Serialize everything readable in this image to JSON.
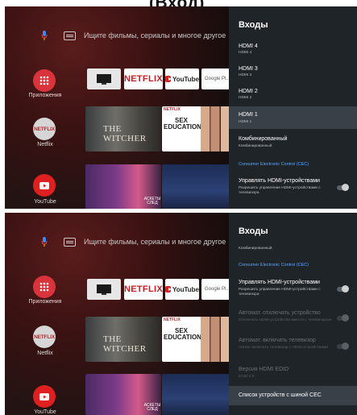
{
  "header": {
    "visible_fragment": "(Вход)"
  },
  "search": {
    "placeholder": "Ищите фильмы, сериалы и многое другое"
  },
  "rows": {
    "apps_label": "Приложения",
    "netflix_label": "Netflix",
    "youtube_label": "YouTube",
    "netflix_icon_text": "NETFLIX"
  },
  "tiles": {
    "netflix": "NETFLIX",
    "youtube": "YouTube",
    "google_play": "Google Pl..."
  },
  "posters": {
    "witcher": "THE WITCHER",
    "sex_education_brand": "NETFLIX",
    "sex_education": "SEX EDUCATION",
    "row3_small": "АСКЕТЫ СЛЕД"
  },
  "panel1": {
    "title": "Входы",
    "items": [
      {
        "title": "HDMI 4",
        "sub": "HDMI 4"
      },
      {
        "title": "HDMI 3",
        "sub": "HDMI 3"
      },
      {
        "title": "HDMI 2",
        "sub": "HDMI 2"
      },
      {
        "title": "HDMI 1",
        "sub": "HDMI 1"
      },
      {
        "title": "Комбинированный",
        "sub": "Комбинированный"
      }
    ],
    "section": "Consumer Electronic Control (CEC)",
    "cec_control": {
      "title": "Управлять HDMI-устройствами",
      "sub": "Разрешить управление HDMI-устройствами с телевизора"
    }
  },
  "panel2": {
    "title": "Входы",
    "top_fragment": "Комбинированный",
    "section": "Consumer Electronic Control (CEC)",
    "items": [
      {
        "title": "Управлять HDMI-устройствами",
        "sub": "Разрешить управление HDMI-устройствами с телевизора"
      },
      {
        "title": "Автомат. отключать устройство",
        "sub": "Отключать HDMI-устройства вместе с телевизором"
      },
      {
        "title": "Автомат. включать телевизор",
        "sub": "Автом. включать телевизор с HDMI-устройствами"
      },
      {
        "title": "Версия HDMI EDID",
        "sub": "EDID 2.0"
      },
      {
        "title": "Список устройств с шиной CEC",
        "sub": ""
      }
    ]
  },
  "colors": {
    "panel_bg": "#1f2429",
    "panel_selected": "#394048",
    "section_accent": "#5aa6ff",
    "netflix_red": "#c91d24",
    "apps_red": "#d9343b"
  }
}
